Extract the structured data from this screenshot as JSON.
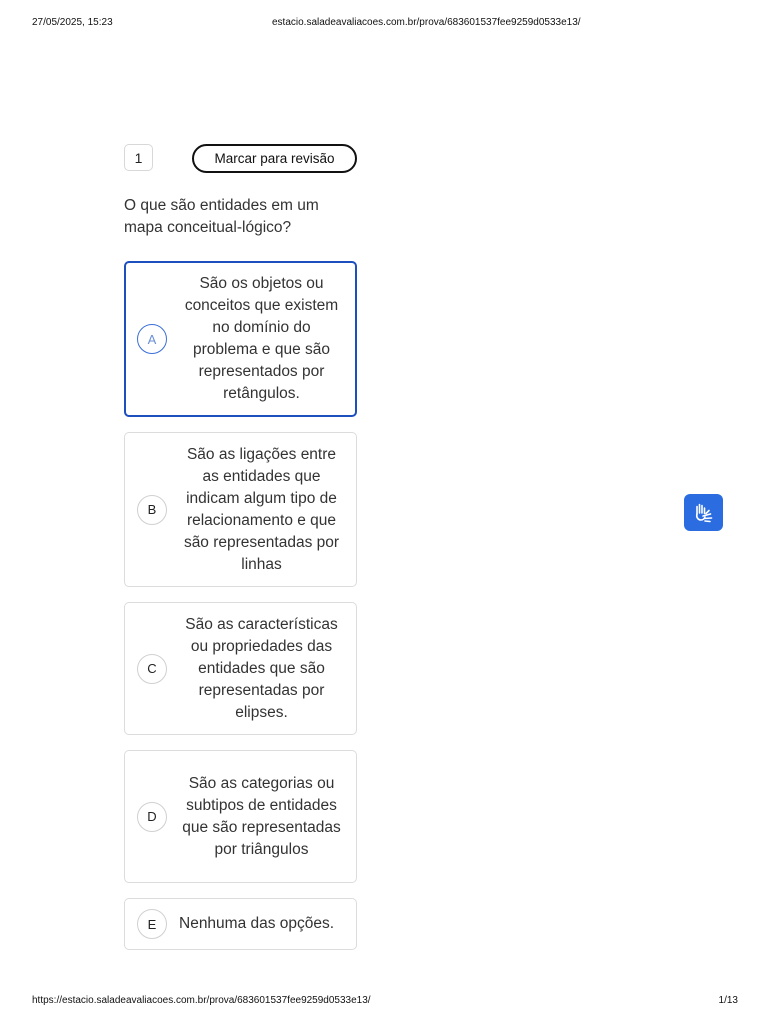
{
  "print_header": {
    "datetime": "27/05/2025, 15:23",
    "url": "estacio.saladeavaliacoes.com.br/prova/683601537fee9259d0533e13/"
  },
  "print_footer": {
    "url": "https://estacio.saladeavaliacoes.com.br/prova/683601537fee9259d0533e13/",
    "page": "1/13"
  },
  "question": {
    "number": "1",
    "review_label": "Marcar para revisão",
    "text": "O que são entidades em um mapa conceitual-lógico?"
  },
  "options": [
    {
      "letter": "A",
      "text": "São os objetos ou conceitos que existem no domínio do problema e que são representados por retângulos.",
      "selected": true
    },
    {
      "letter": "B",
      "text": "São as ligações entre as entidades que indicam algum tipo de relacionamento e que são representadas por linhas",
      "selected": false
    },
    {
      "letter": "C",
      "text": "São as características ou propriedades das entidades que são representadas por elipses.",
      "selected": false
    },
    {
      "letter": "D",
      "text": "São as categorias ou subtipos de entidades que são representadas por triângulos",
      "selected": false
    },
    {
      "letter": "E",
      "text": "Nenhuma das opções.",
      "selected": false
    }
  ],
  "accessibility": {
    "icon": "sign-language-hands-icon",
    "color": "#2b6de0"
  },
  "colors": {
    "selected_border": "#1d4fbf",
    "option_border": "#dcdcdc"
  }
}
